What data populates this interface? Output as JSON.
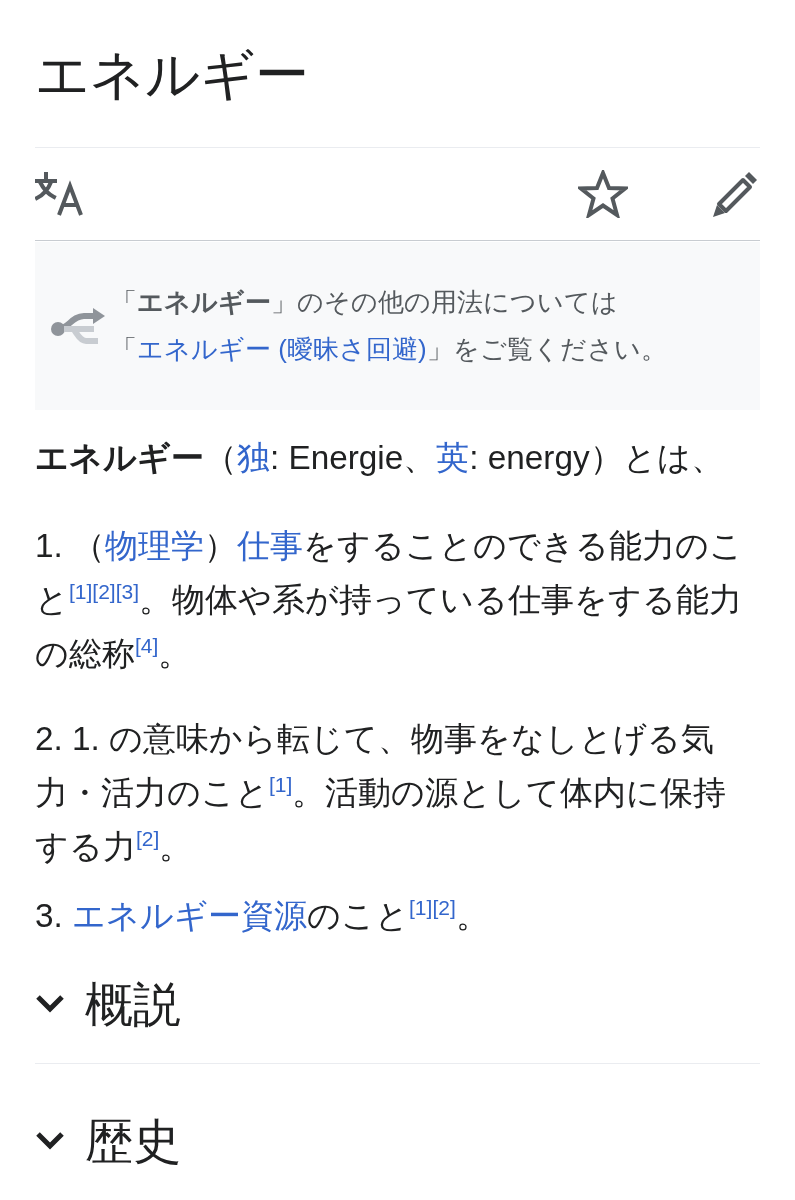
{
  "page_title": "エネルギー",
  "page_actions": [
    {
      "kind": "language"
    },
    {
      "kind": "watch",
      "on": false
    },
    {
      "kind": "edit"
    }
  ],
  "hatnote": {
    "segments": [
      {
        "kind": "text",
        "text": "「**エネルギー**」のその他の用法については「"
      },
      {
        "kind": "link",
        "text": "エネルギー (曖昧さ回避)"
      },
      {
        "kind": "text",
        "text": "」をご覧ください。"
      }
    ]
  },
  "lead": {
    "segments": [
      {
        "kind": "text",
        "text": "**エネルギー**（"
      },
      {
        "kind": "link",
        "text": "独"
      },
      {
        "kind": "text",
        "text": ": Energie、"
      },
      {
        "kind": "link",
        "text": "英"
      },
      {
        "kind": "text",
        "text": ": energy）とは、"
      }
    ]
  },
  "definitions": [
    {
      "segments": [
        {
          "kind": "text",
          "text": "1. （"
        },
        {
          "kind": "link",
          "text": "物理学"
        },
        {
          "kind": "text",
          "text": "）"
        },
        {
          "kind": "link",
          "text": "仕事"
        },
        {
          "kind": "text",
          "text": "をすることのできる能力のこと"
        },
        {
          "kind": "ref",
          "text": "[1]"
        },
        {
          "kind": "ref",
          "text": "[2]"
        },
        {
          "kind": "ref",
          "text": "[3]"
        },
        {
          "kind": "text",
          "text": "。物体や系が持っている仕事をする能力の総称"
        },
        {
          "kind": "ref",
          "text": "[4]"
        },
        {
          "kind": "text",
          "text": "。"
        }
      ]
    },
    {
      "segments": [
        {
          "kind": "text",
          "text": "2. 1. の意味から転じて、物事をなしとげる気力・活力のこと"
        },
        {
          "kind": "ref",
          "text": "[1]"
        },
        {
          "kind": "text",
          "text": "。活動の源として体内に保持する力"
        },
        {
          "kind": "ref",
          "text": "[2]"
        },
        {
          "kind": "text",
          "text": "。"
        }
      ]
    },
    {
      "segments": [
        {
          "kind": "text",
          "text": "3. "
        },
        {
          "kind": "link",
          "text": "エネルギー資源"
        },
        {
          "kind": "text",
          "text": "のこと"
        },
        {
          "kind": "ref",
          "text": "[1]"
        },
        {
          "kind": "ref",
          "text": "[2]"
        },
        {
          "kind": "text",
          "text": "。"
        }
      ]
    }
  ],
  "sections": [
    {
      "title": "概説",
      "expanded": false
    },
    {
      "title": "歴史",
      "expanded": false
    }
  ]
}
